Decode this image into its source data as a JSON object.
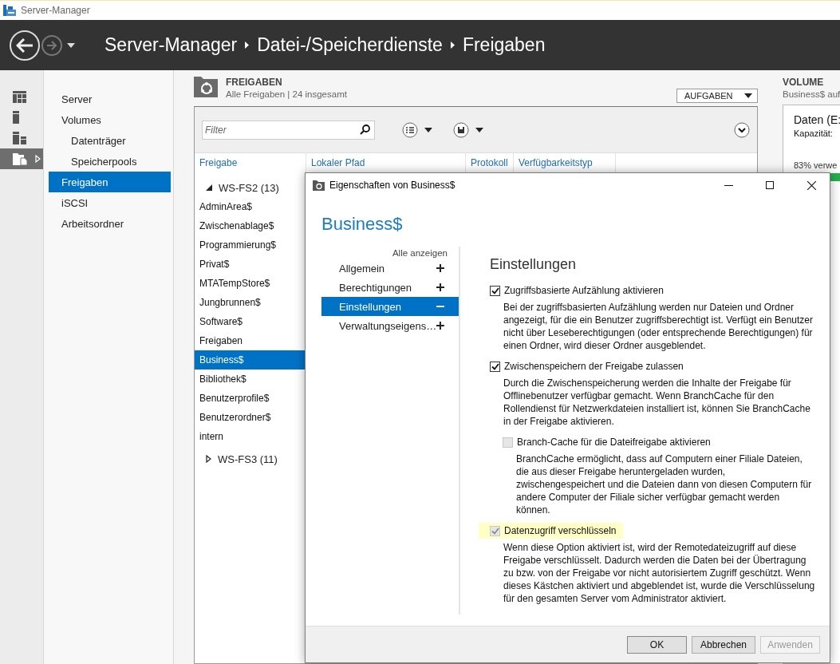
{
  "window": {
    "title": "Server-Manager"
  },
  "header": {
    "breadcrumb": [
      "Server-Manager",
      "Datei-/Speicherdienste",
      "Freigaben"
    ]
  },
  "rail": [
    {
      "kind": "dashboard",
      "selected": false
    },
    {
      "kind": "server",
      "selected": false
    },
    {
      "kind": "servers",
      "selected": false
    },
    {
      "kind": "files",
      "selected": true
    }
  ],
  "nav": [
    {
      "label": "Server",
      "selected": false
    },
    {
      "label": "Volumes",
      "selected": false,
      "children": [
        {
          "label": "Datenträger",
          "selected": false
        },
        {
          "label": "Speicherpools",
          "selected": false
        }
      ]
    },
    {
      "label": "Freigaben",
      "selected": true
    },
    {
      "label": "iSCSI",
      "selected": false
    },
    {
      "label": "Arbeitsordner",
      "selected": false
    }
  ],
  "shares": {
    "title": "FREIGABEN",
    "subtitle": "Alle Freigaben | 24 insgesamt",
    "tasks_button": "AUFGABEN",
    "filter": {
      "placeholder": "Filter"
    },
    "columns": [
      "Freigabe",
      "Lokaler Pfad",
      "Protokoll",
      "Verfügbarkeitstyp"
    ],
    "groups": [
      {
        "label": "WS-FS2 (13)",
        "expanded": true,
        "children": [
          {
            "label": "AdminArea$",
            "selected": false
          },
          {
            "label": "Zwischenablage$",
            "selected": false
          },
          {
            "label": "Programmierung$",
            "selected": false
          },
          {
            "label": "Privat$",
            "selected": false
          },
          {
            "label": "MTATempStore$",
            "selected": false
          },
          {
            "label": "Jungbrunnen$",
            "selected": false
          },
          {
            "label": "Software$",
            "selected": false
          },
          {
            "label": "Freigaben",
            "selected": false
          },
          {
            "label": "Business$",
            "selected": true
          },
          {
            "label": "Bibliothek$",
            "selected": false
          },
          {
            "label": "Benutzerprofile$",
            "selected": false
          },
          {
            "label": "Benutzerordner$",
            "selected": false
          },
          {
            "label": "intern",
            "selected": false
          }
        ]
      },
      {
        "label": "WS-FS3 (11)",
        "expanded": false
      }
    ]
  },
  "volume": {
    "title": "VOLUME",
    "subtitle": "Business$ auf",
    "card": {
      "name": "Daten (E:",
      "capacity_label": "Kapazität:",
      "usage": "83% verwe",
      "level": 0.83
    }
  },
  "dialog": {
    "title": "Eigenschaften von Business$",
    "heading": "Business$",
    "show_all": "Alle anzeigen",
    "sections": [
      {
        "label": "Allgemein",
        "expanded": false,
        "selected": false
      },
      {
        "label": "Berechtigungen",
        "expanded": false,
        "selected": false
      },
      {
        "label": "Einstellungen",
        "expanded": true,
        "selected": true
      },
      {
        "label": "Verwaltungseigens…",
        "expanded": false,
        "selected": false
      }
    ],
    "content_title": "Einstellungen",
    "options": [
      {
        "label": "Zugriffsbasierte Aufzählung aktivieren",
        "checked": true,
        "disabled": false,
        "highlighted": false,
        "indented": false,
        "description": "Bei der zugriffsbasierten Aufzählung werden nur Dateien und Ordner angezeigt, für die ein Benutzer zugriffsberechtigt ist. Verfügt ein Benutzer nicht über Leseberechtigungen (oder entsprechende Berechtigungen) für einen Ordner, wird dieser Ordner ausgeblendet."
      },
      {
        "label": "Zwischenspeichern der Freigabe zulassen",
        "checked": true,
        "disabled": false,
        "highlighted": false,
        "indented": false,
        "description": "Durch die Zwischenspeicherung werden die Inhalte der Freigabe für Offlinebenutzer verfügbar gemacht. Wenn BranchCache für den Rollendienst für Netzwerkdateien installiert ist, können Sie BranchCache in der Freigabe aktivieren."
      },
      {
        "label": "Branch-Cache für die Dateifreigabe aktivieren",
        "checked": false,
        "disabled": true,
        "highlighted": false,
        "indented": true,
        "description": "BranchCache ermöglicht, dass auf Computern einer Filiale Dateien, die aus dieser Freigabe heruntergeladen wurden, zwischengespeichert und die Dateien dann von diesen Computern für andere Computer der Filiale sicher verfügbar gemacht werden können."
      },
      {
        "label": "Datenzugriff verschlüsseln",
        "checked": true,
        "disabled": true,
        "highlighted": true,
        "indented": false,
        "description": "Wenn diese Option aktiviert ist, wird der Remotedateizugriff auf diese Freigabe verschlüsselt. Dadurch werden die Daten bei der Übertragung zu bzw. von der Freigabe vor nicht autorisiertem Zugriff geschützt. Wenn dieses Kästchen aktiviert und abgeblendet ist, wurde die Verschlüsselung für den gesamten Server vom Administrator aktiviert."
      }
    ],
    "buttons": [
      {
        "label": "OK",
        "disabled": false,
        "default": true
      },
      {
        "label": "Abbrechen",
        "disabled": false,
        "default": false
      },
      {
        "label": "Anwenden",
        "disabled": true,
        "default": false
      }
    ]
  }
}
